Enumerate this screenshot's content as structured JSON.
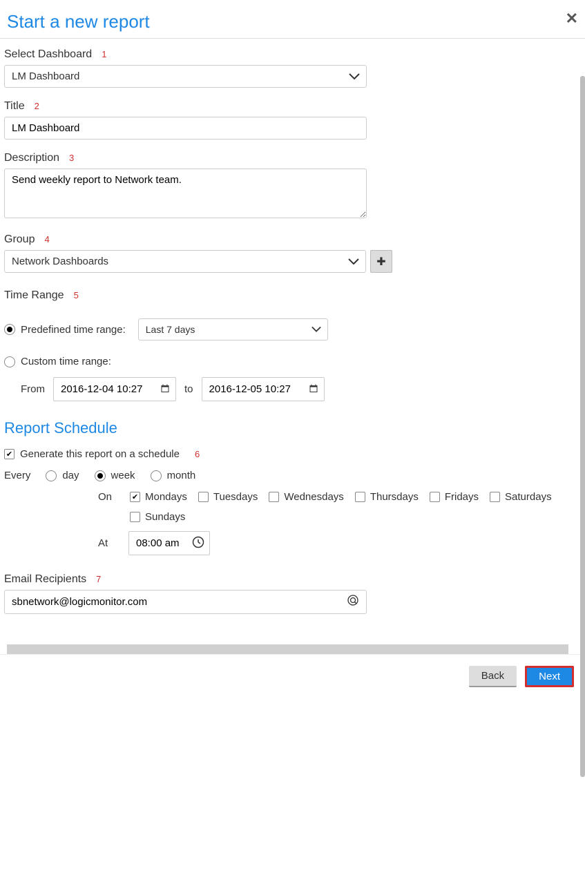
{
  "header": {
    "title": "Start a new report"
  },
  "annotations": [
    "1",
    "2",
    "3",
    "4",
    "5",
    "6",
    "7"
  ],
  "fields": {
    "dashboard": {
      "label": "Select Dashboard",
      "value": "LM Dashboard"
    },
    "title": {
      "label": "Title",
      "value": "LM Dashboard"
    },
    "description": {
      "label": "Description",
      "value": "Send weekly report to Network team."
    },
    "group": {
      "label": "Group",
      "value": "Network Dashboards"
    },
    "timeRange": {
      "label": "Time Range",
      "predefinedLabel": "Predefined time range:",
      "predefinedValue": "Last 7 days",
      "customLabel": "Custom time range:",
      "fromLabel": "From",
      "fromValue": "2016-12-04 10:27",
      "toLabel": "to",
      "toValue": "2016-12-05 10:27",
      "selected": "predefined"
    }
  },
  "schedule": {
    "heading": "Report Schedule",
    "generateLabel": "Generate this report on a schedule",
    "generateChecked": true,
    "everyLabel": "Every",
    "freq": {
      "day": "day",
      "week": "week",
      "month": "month",
      "selected": "week"
    },
    "onLabel": "On",
    "days": {
      "Mondays": true,
      "Tuesdays": false,
      "Wednesdays": false,
      "Thursdays": false,
      "Fridays": false,
      "Saturdays": false,
      "Sundays": false
    },
    "atLabel": "At",
    "atValue": "08:00 am"
  },
  "email": {
    "label": "Email Recipients",
    "value": "sbnetwork@logicmonitor.com"
  },
  "footer": {
    "back": "Back",
    "next": "Next"
  }
}
